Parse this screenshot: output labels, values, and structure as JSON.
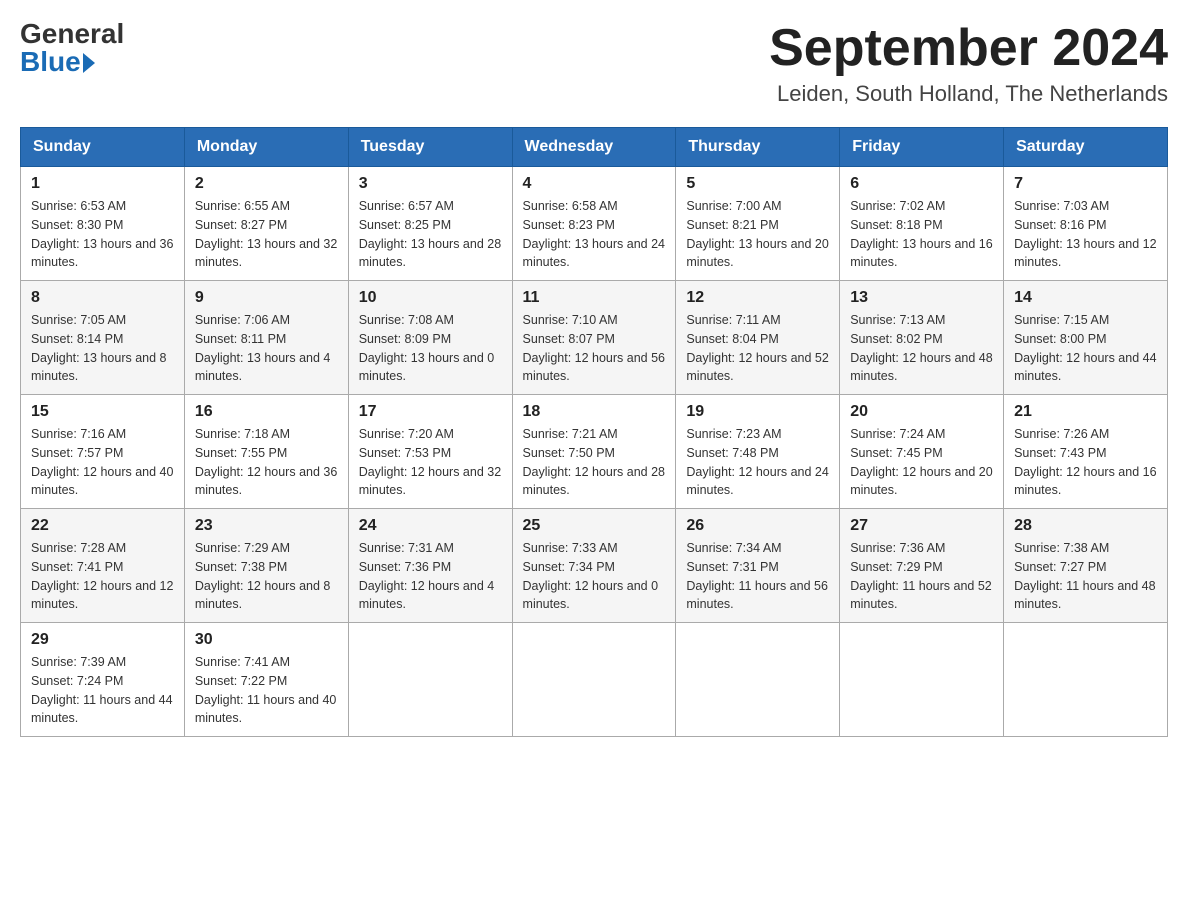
{
  "header": {
    "logo_general": "General",
    "logo_blue": "Blue",
    "month_title": "September 2024",
    "location": "Leiden, South Holland, The Netherlands"
  },
  "weekdays": [
    "Sunday",
    "Monday",
    "Tuesday",
    "Wednesday",
    "Thursday",
    "Friday",
    "Saturday"
  ],
  "weeks": [
    [
      {
        "day": "1",
        "sunrise": "6:53 AM",
        "sunset": "8:30 PM",
        "daylight": "13 hours and 36 minutes."
      },
      {
        "day": "2",
        "sunrise": "6:55 AM",
        "sunset": "8:27 PM",
        "daylight": "13 hours and 32 minutes."
      },
      {
        "day": "3",
        "sunrise": "6:57 AM",
        "sunset": "8:25 PM",
        "daylight": "13 hours and 28 minutes."
      },
      {
        "day": "4",
        "sunrise": "6:58 AM",
        "sunset": "8:23 PM",
        "daylight": "13 hours and 24 minutes."
      },
      {
        "day": "5",
        "sunrise": "7:00 AM",
        "sunset": "8:21 PM",
        "daylight": "13 hours and 20 minutes."
      },
      {
        "day": "6",
        "sunrise": "7:02 AM",
        "sunset": "8:18 PM",
        "daylight": "13 hours and 16 minutes."
      },
      {
        "day": "7",
        "sunrise": "7:03 AM",
        "sunset": "8:16 PM",
        "daylight": "13 hours and 12 minutes."
      }
    ],
    [
      {
        "day": "8",
        "sunrise": "7:05 AM",
        "sunset": "8:14 PM",
        "daylight": "13 hours and 8 minutes."
      },
      {
        "day": "9",
        "sunrise": "7:06 AM",
        "sunset": "8:11 PM",
        "daylight": "13 hours and 4 minutes."
      },
      {
        "day": "10",
        "sunrise": "7:08 AM",
        "sunset": "8:09 PM",
        "daylight": "13 hours and 0 minutes."
      },
      {
        "day": "11",
        "sunrise": "7:10 AM",
        "sunset": "8:07 PM",
        "daylight": "12 hours and 56 minutes."
      },
      {
        "day": "12",
        "sunrise": "7:11 AM",
        "sunset": "8:04 PM",
        "daylight": "12 hours and 52 minutes."
      },
      {
        "day": "13",
        "sunrise": "7:13 AM",
        "sunset": "8:02 PM",
        "daylight": "12 hours and 48 minutes."
      },
      {
        "day": "14",
        "sunrise": "7:15 AM",
        "sunset": "8:00 PM",
        "daylight": "12 hours and 44 minutes."
      }
    ],
    [
      {
        "day": "15",
        "sunrise": "7:16 AM",
        "sunset": "7:57 PM",
        "daylight": "12 hours and 40 minutes."
      },
      {
        "day": "16",
        "sunrise": "7:18 AM",
        "sunset": "7:55 PM",
        "daylight": "12 hours and 36 minutes."
      },
      {
        "day": "17",
        "sunrise": "7:20 AM",
        "sunset": "7:53 PM",
        "daylight": "12 hours and 32 minutes."
      },
      {
        "day": "18",
        "sunrise": "7:21 AM",
        "sunset": "7:50 PM",
        "daylight": "12 hours and 28 minutes."
      },
      {
        "day": "19",
        "sunrise": "7:23 AM",
        "sunset": "7:48 PM",
        "daylight": "12 hours and 24 minutes."
      },
      {
        "day": "20",
        "sunrise": "7:24 AM",
        "sunset": "7:45 PM",
        "daylight": "12 hours and 20 minutes."
      },
      {
        "day": "21",
        "sunrise": "7:26 AM",
        "sunset": "7:43 PM",
        "daylight": "12 hours and 16 minutes."
      }
    ],
    [
      {
        "day": "22",
        "sunrise": "7:28 AM",
        "sunset": "7:41 PM",
        "daylight": "12 hours and 12 minutes."
      },
      {
        "day": "23",
        "sunrise": "7:29 AM",
        "sunset": "7:38 PM",
        "daylight": "12 hours and 8 minutes."
      },
      {
        "day": "24",
        "sunrise": "7:31 AM",
        "sunset": "7:36 PM",
        "daylight": "12 hours and 4 minutes."
      },
      {
        "day": "25",
        "sunrise": "7:33 AM",
        "sunset": "7:34 PM",
        "daylight": "12 hours and 0 minutes."
      },
      {
        "day": "26",
        "sunrise": "7:34 AM",
        "sunset": "7:31 PM",
        "daylight": "11 hours and 56 minutes."
      },
      {
        "day": "27",
        "sunrise": "7:36 AM",
        "sunset": "7:29 PM",
        "daylight": "11 hours and 52 minutes."
      },
      {
        "day": "28",
        "sunrise": "7:38 AM",
        "sunset": "7:27 PM",
        "daylight": "11 hours and 48 minutes."
      }
    ],
    [
      {
        "day": "29",
        "sunrise": "7:39 AM",
        "sunset": "7:24 PM",
        "daylight": "11 hours and 44 minutes."
      },
      {
        "day": "30",
        "sunrise": "7:41 AM",
        "sunset": "7:22 PM",
        "daylight": "11 hours and 40 minutes."
      },
      null,
      null,
      null,
      null,
      null
    ]
  ]
}
